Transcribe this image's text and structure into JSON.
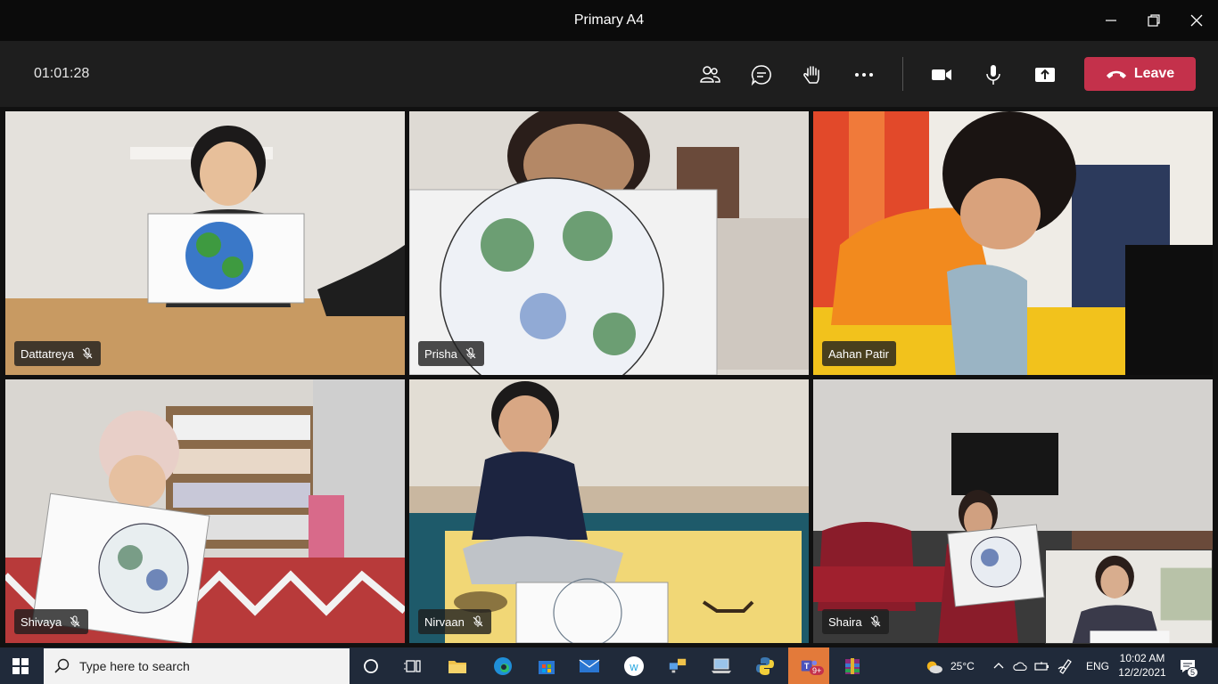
{
  "window": {
    "title": "Primary A4"
  },
  "toolbar": {
    "timer": "01:01:28",
    "leave_label": "Leave",
    "accent": "#c4314b"
  },
  "participants": [
    {
      "name": "Dattatreya",
      "mic": "muted"
    },
    {
      "name": "Prisha",
      "mic": "muted"
    },
    {
      "name": "Aahan Patir",
      "mic": "on"
    },
    {
      "name": "Shivaya",
      "mic": "muted"
    },
    {
      "name": "Nirvaan",
      "mic": "muted"
    },
    {
      "name": "Shaira",
      "mic": "muted"
    }
  ],
  "taskbar": {
    "search_placeholder": "Type here to search",
    "teams_badge": "9+",
    "weather": "25°C",
    "language": "ENG",
    "time": "10:02 AM",
    "date": "12/2/2021",
    "notifications": "5"
  }
}
